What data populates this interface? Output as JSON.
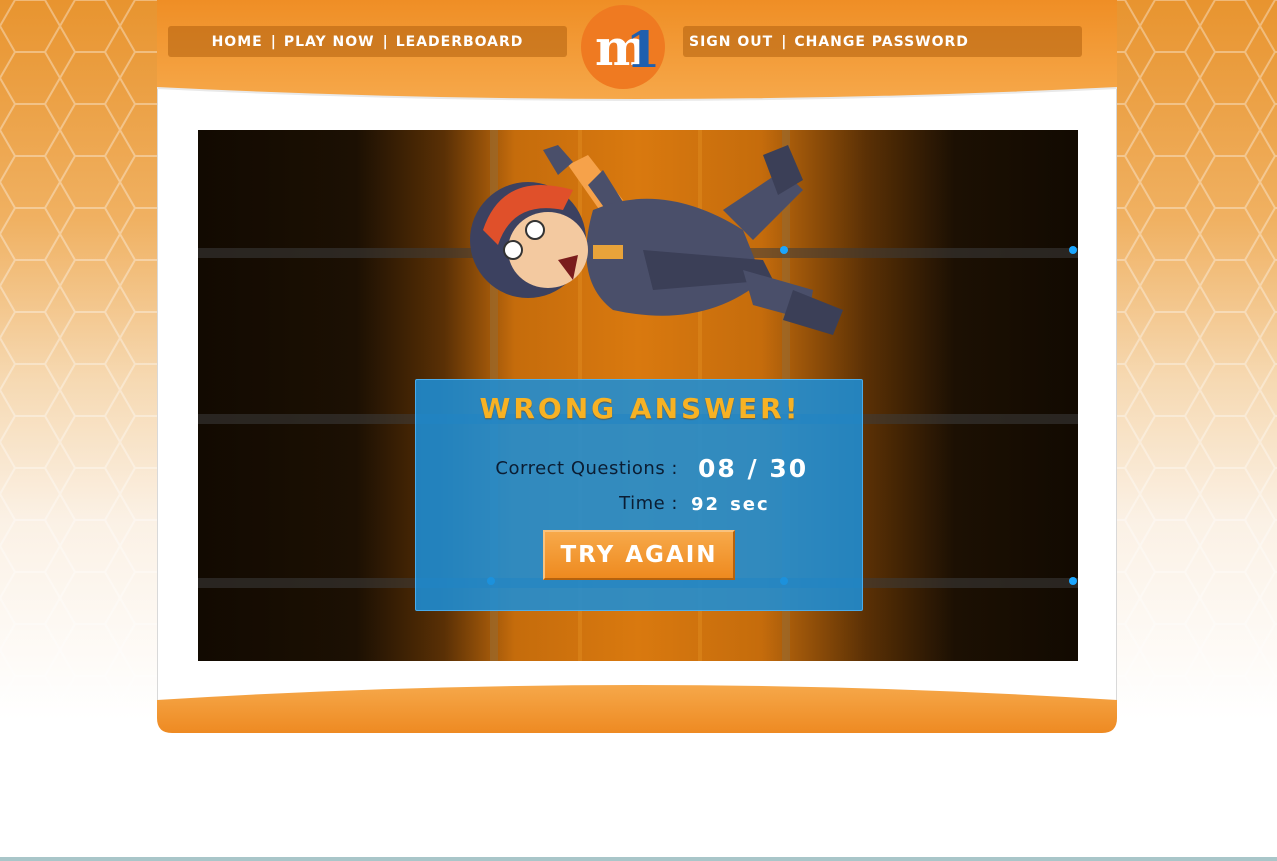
{
  "nav": {
    "home": "HOME",
    "play_now": "PLAY NOW",
    "leaderboard": "LEADERBOARD",
    "sign_out": "SIGN OUT",
    "change_password": "CHANGE PASSWORD",
    "separator": "|"
  },
  "logo": {
    "text": "m1",
    "icon": "m1-logo"
  },
  "game": {
    "result_title": "WRONG ANSWER!",
    "correct_label": "Correct Questions :",
    "correct_value": "08 / 30",
    "time_label": "Time :",
    "time_value": "92",
    "time_unit": "sec",
    "try_again_label": "TRY AGAIN",
    "character_icon": "astronaut-character-icon"
  },
  "colors": {
    "brand_orange": "#ef8a22",
    "panel_blue": "#1c8ed7",
    "title_gold": "#f7b224",
    "logo_blue": "#1f5fae"
  }
}
